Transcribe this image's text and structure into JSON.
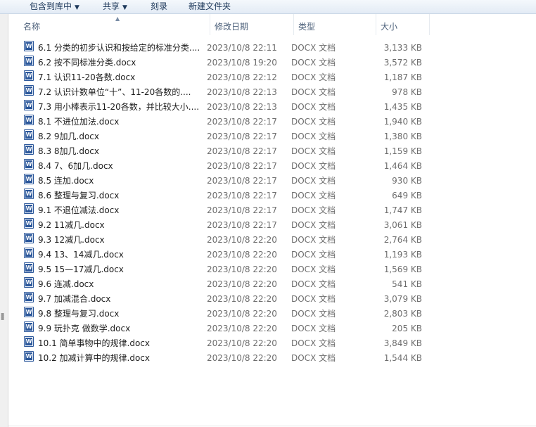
{
  "toolbar": {
    "include_in_library": "包含到库中",
    "share": "共享",
    "burn": "刻录",
    "new_folder": "新建文件夹"
  },
  "columns": {
    "name": "名称",
    "date": "修改日期",
    "type": "类型",
    "size": "大小"
  },
  "files": [
    {
      "name": "6.1 分类的初步认识和按给定的标准分类....",
      "date": "2023/10/8 22:11",
      "type": "DOCX 文档",
      "size": "3,133 KB"
    },
    {
      "name": "6.2 按不同标准分类.docx",
      "date": "2023/10/8 19:20",
      "type": "DOCX 文档",
      "size": "3,572 KB"
    },
    {
      "name": "7.1 认识11-20各数.docx",
      "date": "2023/10/8 22:12",
      "type": "DOCX 文档",
      "size": "1,187 KB"
    },
    {
      "name": "7.2 认识计数单位“十”、11-20各数的....",
      "date": "2023/10/8 22:13",
      "type": "DOCX 文档",
      "size": "978 KB"
    },
    {
      "name": "7.3 用小棒表示11-20各数，并比较大小....",
      "date": "2023/10/8 22:13",
      "type": "DOCX 文档",
      "size": "1,435 KB"
    },
    {
      "name": "8.1 不进位加法.docx",
      "date": "2023/10/8 22:17",
      "type": "DOCX 文档",
      "size": "1,940 KB"
    },
    {
      "name": "8.2 9加几.docx",
      "date": "2023/10/8 22:17",
      "type": "DOCX 文档",
      "size": "1,380 KB"
    },
    {
      "name": "8.3 8加几.docx",
      "date": "2023/10/8 22:17",
      "type": "DOCX 文档",
      "size": "1,159 KB"
    },
    {
      "name": "8.4 7、6加几.docx",
      "date": "2023/10/8 22:17",
      "type": "DOCX 文档",
      "size": "1,464 KB"
    },
    {
      "name": "8.5 连加.docx",
      "date": "2023/10/8 22:17",
      "type": "DOCX 文档",
      "size": "930 KB"
    },
    {
      "name": "8.6 整理与复习.docx",
      "date": "2023/10/8 22:17",
      "type": "DOCX 文档",
      "size": "649 KB"
    },
    {
      "name": "9.1 不退位减法.docx",
      "date": "2023/10/8 22:17",
      "type": "DOCX 文档",
      "size": "1,747 KB"
    },
    {
      "name": "9.2 11减几.docx",
      "date": "2023/10/8 22:17",
      "type": "DOCX 文档",
      "size": "3,061 KB"
    },
    {
      "name": "9.3 12减几.docx",
      "date": "2023/10/8 22:20",
      "type": "DOCX 文档",
      "size": "2,764 KB"
    },
    {
      "name": "9.4 13、14减几.docx",
      "date": "2023/10/8 22:20",
      "type": "DOCX 文档",
      "size": "1,193 KB"
    },
    {
      "name": "9.5 15—17减几.docx",
      "date": "2023/10/8 22:20",
      "type": "DOCX 文档",
      "size": "1,569 KB"
    },
    {
      "name": "9.6 连减.docx",
      "date": "2023/10/8 22:20",
      "type": "DOCX 文档",
      "size": "541 KB"
    },
    {
      "name": "9.7 加减混合.docx",
      "date": "2023/10/8 22:20",
      "type": "DOCX 文档",
      "size": "3,079 KB"
    },
    {
      "name": "9.8 整理与复习.docx",
      "date": "2023/10/8 22:20",
      "type": "DOCX 文档",
      "size": "2,803 KB"
    },
    {
      "name": "9.9  玩扑克 做数学.docx",
      "date": "2023/10/8 22:20",
      "type": "DOCX 文档",
      "size": "205 KB"
    },
    {
      "name": "10.1 简单事物中的规律.docx",
      "date": "2023/10/8 22:20",
      "type": "DOCX 文档",
      "size": "3,849 KB"
    },
    {
      "name": "10.2 加减计算中的规律.docx",
      "date": "2023/10/8 22:20",
      "type": "DOCX 文档",
      "size": "1,544 KB"
    }
  ]
}
